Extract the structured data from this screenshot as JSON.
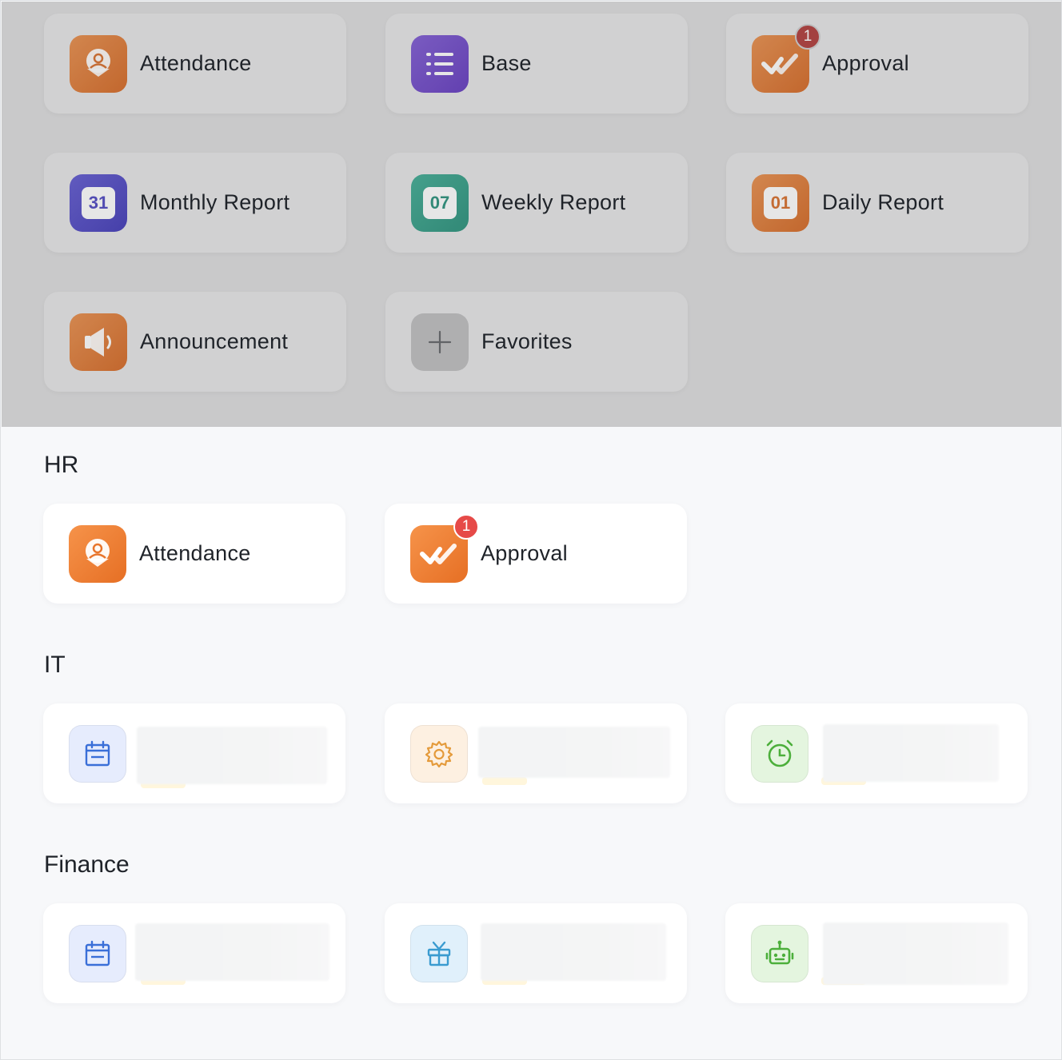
{
  "favorites": [
    {
      "label": "Attendance",
      "icon": "attendance-icon",
      "color": "#e8752c"
    },
    {
      "label": "Base",
      "icon": "base-list-icon",
      "color": "#7a50dc"
    },
    {
      "label": "Approval",
      "icon": "approval-icon",
      "color": "#e8752c",
      "badge": "1"
    },
    {
      "label": "Monthly Report",
      "icon": "calendar-31-icon",
      "color": "#5a52d8",
      "day": "31"
    },
    {
      "label": "Weekly Report",
      "icon": "calendar-07-icon",
      "color": "#34a88f",
      "day": "07"
    },
    {
      "label": "Daily Report",
      "icon": "calendar-01-icon",
      "color": "#e8752c",
      "day": "01"
    },
    {
      "label": "Announcement",
      "icon": "megaphone-icon",
      "color": "#e8752c"
    },
    {
      "label": "Favorites",
      "icon": "plus-icon",
      "color": "#c2c2c4"
    }
  ],
  "sections": {
    "hr": {
      "title": "HR",
      "apps": [
        {
          "label": "Attendance",
          "icon": "attendance-icon"
        },
        {
          "label": "Approval",
          "icon": "approval-icon",
          "badge": "1"
        }
      ]
    },
    "it": {
      "title": "IT",
      "apps": [
        {
          "icon": "calendar-icon",
          "color": "#3a6fd8"
        },
        {
          "icon": "gear-icon",
          "color": "#e49a3a"
        },
        {
          "icon": "alarm-clock-icon",
          "color": "#4caf3b"
        }
      ]
    },
    "finance": {
      "title": "Finance",
      "apps": [
        {
          "icon": "calendar-icon",
          "color": "#3a6fd8"
        },
        {
          "icon": "gift-icon",
          "color": "#3a9bd0"
        },
        {
          "icon": "robot-icon",
          "color": "#4caf3b"
        }
      ]
    }
  }
}
